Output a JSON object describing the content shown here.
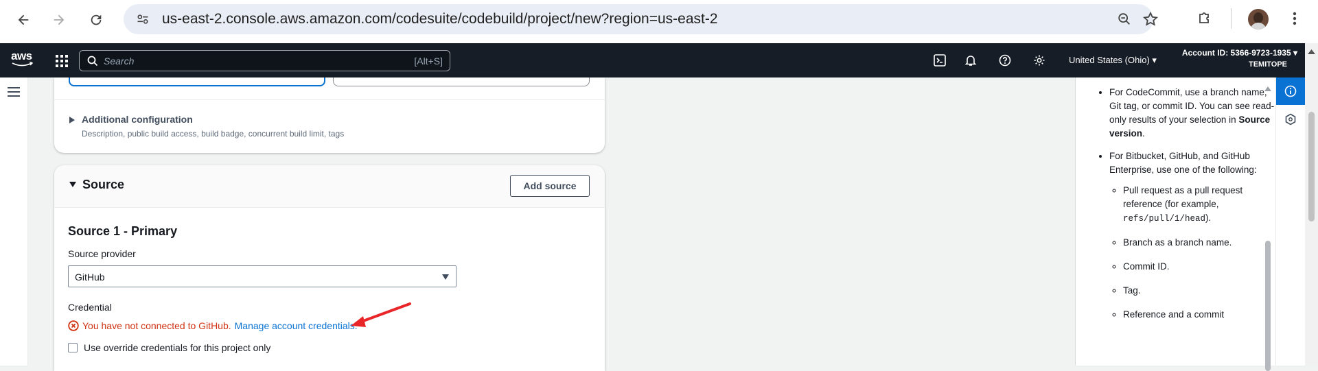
{
  "browser": {
    "url": "us-east-2.console.aws.amazon.com/codesuite/codebuild/project/new?region=us-east-2",
    "icons": [
      "back-arrow-icon",
      "forward-arrow-icon",
      "reload-icon",
      "site-info-icon",
      "zoom-out-icon",
      "star-icon",
      "extensions-icon",
      "profile-avatar",
      "more-vert-icon"
    ]
  },
  "aws_header": {
    "logo": "aws",
    "search_placeholder": "Search",
    "search_shortcut": "[Alt+S]",
    "region": "United States (Ohio) ▾",
    "account": "Account ID: 5366-9723-1935 ▾",
    "user": "TEMITOPE"
  },
  "additional_config": {
    "title": "Additional configuration",
    "description": "Description, public build access, build badge, concurrent build limit, tags"
  },
  "source": {
    "title": "Source",
    "add_button": "Add source",
    "primary_title": "Source 1 - Primary",
    "provider_label": "Source provider",
    "provider_value": "GitHub",
    "credential_label": "Credential",
    "error_text": "You have not connected to GitHub.",
    "error_link": "Manage account credentials.",
    "override_label": "Use override credentials for this project only"
  },
  "help_panel": {
    "item1_pre": "For CodeCommit, use a branch name, Git tag, or commit ID. You can see read-only results of your selection in ",
    "item1_bold": "Source version",
    "item1_post": ".",
    "item2": "For Bitbucket, GitHub, and GitHub Enterprise, use one of the following:",
    "sub1_pre": "Pull request as a pull request reference (for example, ",
    "sub1_code": "refs/pull/1/head",
    "sub1_post": ").",
    "sub2": "Branch as a branch name.",
    "sub3": "Commit ID.",
    "sub4": "Tag.",
    "sub5": "Reference and a commit"
  },
  "colors": {
    "aws_header_bg": "#161d26",
    "error_red": "#d13212",
    "link_blue": "#0972d3",
    "annotation_arrow": "#e8262a"
  }
}
